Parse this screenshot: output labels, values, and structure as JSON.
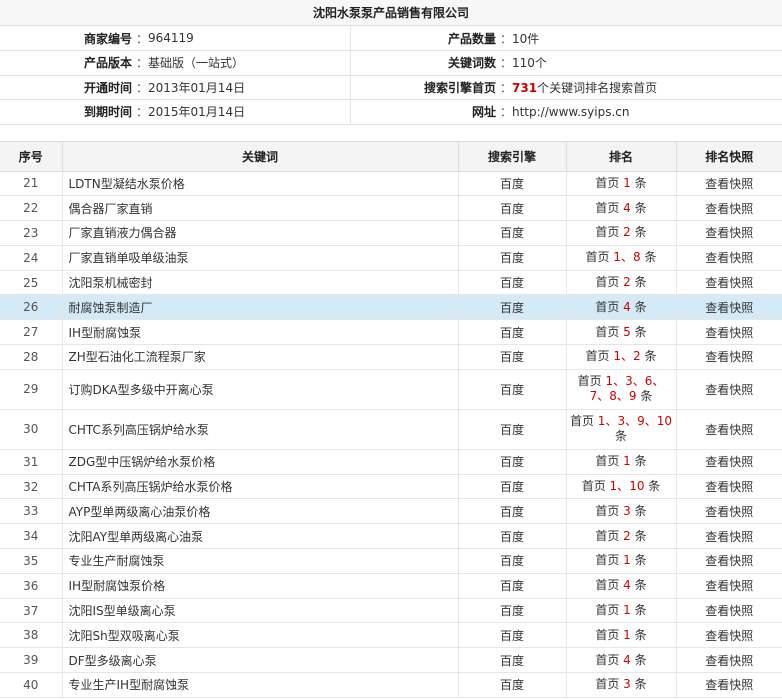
{
  "title": "沈阳水泵泵产品销售有限公司",
  "info": {
    "rows": [
      {
        "l1": "商家编号",
        "v1": "964119",
        "l2": "产品数量",
        "v2": "10件"
      },
      {
        "l1": "产品版本",
        "v1": "基础版（一站式）",
        "l2": "关键词数",
        "v2": "110个"
      },
      {
        "l1": "开通时间",
        "v1": "2013年01月14日",
        "l2": "搜索引擎首页",
        "v2_num": "731",
        "v2": "个关键词排名搜索首页"
      },
      {
        "l1": "到期时间",
        "v1": "2015年01月14日",
        "l2": "网址",
        "v2": "http://www.syips.cn"
      }
    ],
    "separator": "：",
    "colors": {
      "highlight_number": "#cc0000"
    }
  },
  "table": {
    "headers": {
      "no": "序号",
      "keyword": "关键词",
      "engine": "搜索引擎",
      "rank": "排名",
      "snapshot": "排名快照"
    },
    "rank_prefix": "首页",
    "rank_suffix": "条",
    "rank_sep": "、",
    "rows": [
      {
        "no": "21",
        "keyword": "LDTN型凝结水泵价格",
        "engine": "百度",
        "ranks": [
          "1"
        ],
        "snapshot": "查看快照"
      },
      {
        "no": "22",
        "keyword": "偶合器厂家直销",
        "engine": "百度",
        "ranks": [
          "4"
        ],
        "snapshot": "查看快照"
      },
      {
        "no": "23",
        "keyword": "厂家直销液力偶合器",
        "engine": "百度",
        "ranks": [
          "2"
        ],
        "snapshot": "查看快照"
      },
      {
        "no": "24",
        "keyword": "厂家直销单吸单级油泵",
        "engine": "百度",
        "ranks": [
          "1",
          "8"
        ],
        "snapshot": "查看快照"
      },
      {
        "no": "25",
        "keyword": "沈阳泵机械密封",
        "engine": "百度",
        "ranks": [
          "2"
        ],
        "snapshot": "查看快照"
      },
      {
        "no": "26",
        "keyword": "耐腐蚀泵制造厂",
        "engine": "百度",
        "ranks": [
          "4"
        ],
        "snapshot": "查看快照",
        "highlighted": true
      },
      {
        "no": "27",
        "keyword": "IH型耐腐蚀泵",
        "engine": "百度",
        "ranks": [
          "5"
        ],
        "snapshot": "查看快照"
      },
      {
        "no": "28",
        "keyword": "ZH型石油化工流程泵厂家",
        "engine": "百度",
        "ranks": [
          "1",
          "2"
        ],
        "snapshot": "查看快照"
      },
      {
        "no": "29",
        "keyword": "订购DKA型多级中开离心泵",
        "engine": "百度",
        "ranks": [
          "1",
          "3",
          "6",
          "7",
          "8",
          "9"
        ],
        "snapshot": "查看快照",
        "tall": true
      },
      {
        "no": "30",
        "keyword": "CHTC系列高压锅炉给水泵",
        "engine": "百度",
        "ranks": [
          "1",
          "3",
          "9",
          "10"
        ],
        "snapshot": "查看快照",
        "tall": true
      },
      {
        "no": "31",
        "keyword": "ZDG型中压锅炉给水泵价格",
        "engine": "百度",
        "ranks": [
          "1"
        ],
        "snapshot": "查看快照"
      },
      {
        "no": "32",
        "keyword": "CHTA系列高压锅炉给水泵价格",
        "engine": "百度",
        "ranks": [
          "1",
          "10"
        ],
        "snapshot": "查看快照"
      },
      {
        "no": "33",
        "keyword": "AYP型单两级离心油泵价格",
        "engine": "百度",
        "ranks": [
          "3"
        ],
        "snapshot": "查看快照"
      },
      {
        "no": "34",
        "keyword": "沈阳AY型单两级离心油泵",
        "engine": "百度",
        "ranks": [
          "2"
        ],
        "snapshot": "查看快照"
      },
      {
        "no": "35",
        "keyword": "专业生产耐腐蚀泵",
        "engine": "百度",
        "ranks": [
          "1"
        ],
        "snapshot": "查看快照"
      },
      {
        "no": "36",
        "keyword": "IH型耐腐蚀泵价格",
        "engine": "百度",
        "ranks": [
          "4"
        ],
        "snapshot": "查看快照"
      },
      {
        "no": "37",
        "keyword": "沈阳IS型单级离心泵",
        "engine": "百度",
        "ranks": [
          "1"
        ],
        "snapshot": "查看快照"
      },
      {
        "no": "38",
        "keyword": "沈阳Sh型双吸离心泵",
        "engine": "百度",
        "ranks": [
          "1"
        ],
        "snapshot": "查看快照"
      },
      {
        "no": "39",
        "keyword": "DF型多级离心泵",
        "engine": "百度",
        "ranks": [
          "4"
        ],
        "snapshot": "查看快照"
      },
      {
        "no": "40",
        "keyword": "专业生产IH型耐腐蚀泵",
        "engine": "百度",
        "ranks": [
          "3"
        ],
        "snapshot": "查看快照"
      }
    ]
  }
}
